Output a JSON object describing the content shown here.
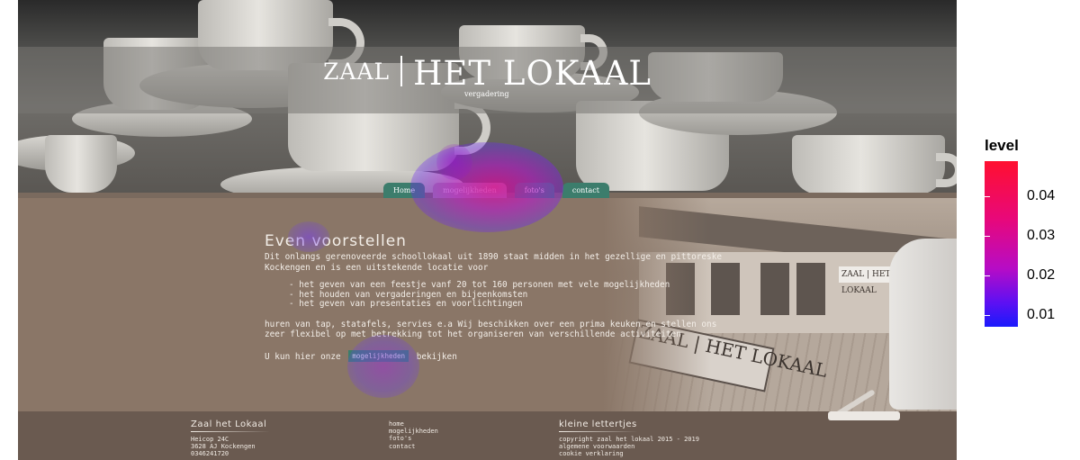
{
  "site": {
    "brand": {
      "prefix": "ZAAL",
      "name": "HET LOKAAL",
      "sub": "vergadering"
    },
    "nav": [
      {
        "label": "Home",
        "active": false
      },
      {
        "label": "mogelijkheden",
        "active": true
      },
      {
        "label": "foto's",
        "active": false
      },
      {
        "label": "contact",
        "active": false
      }
    ],
    "intro": {
      "heading": "Even voorstellen",
      "paragraph": "Dit onlangs gerenoveerde schoollokaal uit 1890 staat midden in het gezellige en pittoreske Kockengen en is een uitstekende locatie voor",
      "list": [
        "- het geven van een feestje vanf 20 tot 160 personen met vele mogelijkheden",
        "- het houden van vergaderingen en bijeenkomsten",
        "- het geven van presentaties en voorlichtingen"
      ],
      "paragraph2": "huren van tap, statafels, servies e.a Wij beschikken over een prima keuken en stellen ons zeer flexibel op met betrekking tot het organiseren van verschillende activiteiten",
      "more_prefix": "U kun hier onze",
      "more_button": "mogelijkheden",
      "more_suffix": "bekijken"
    },
    "photo": {
      "sign_text": "ZAAL | HET LOKAAL",
      "wall_sign": "ZAAL | HET LOKAAL"
    },
    "footer": {
      "address": {
        "title": "Zaal het Lokaal",
        "lines": [
          "Heicop 24C",
          "3628 AJ Kockengen",
          "0346241720"
        ]
      },
      "links": [
        "home",
        "mogelijkheden",
        "foto's",
        "contact"
      ],
      "legal": {
        "title": "kleine lettertjes",
        "lines": [
          "copyright zaal het lokaal 2015 - 2019",
          "algemene voorwaarden",
          "cookie verklaring"
        ]
      }
    }
  },
  "legend": {
    "title": "level",
    "ticks": [
      "0.04",
      "0.03",
      "0.02",
      "0.01"
    ],
    "colors": {
      "high": "#ff1030",
      "mid": "#b60cc6",
      "low": "#1a1afc"
    }
  }
}
